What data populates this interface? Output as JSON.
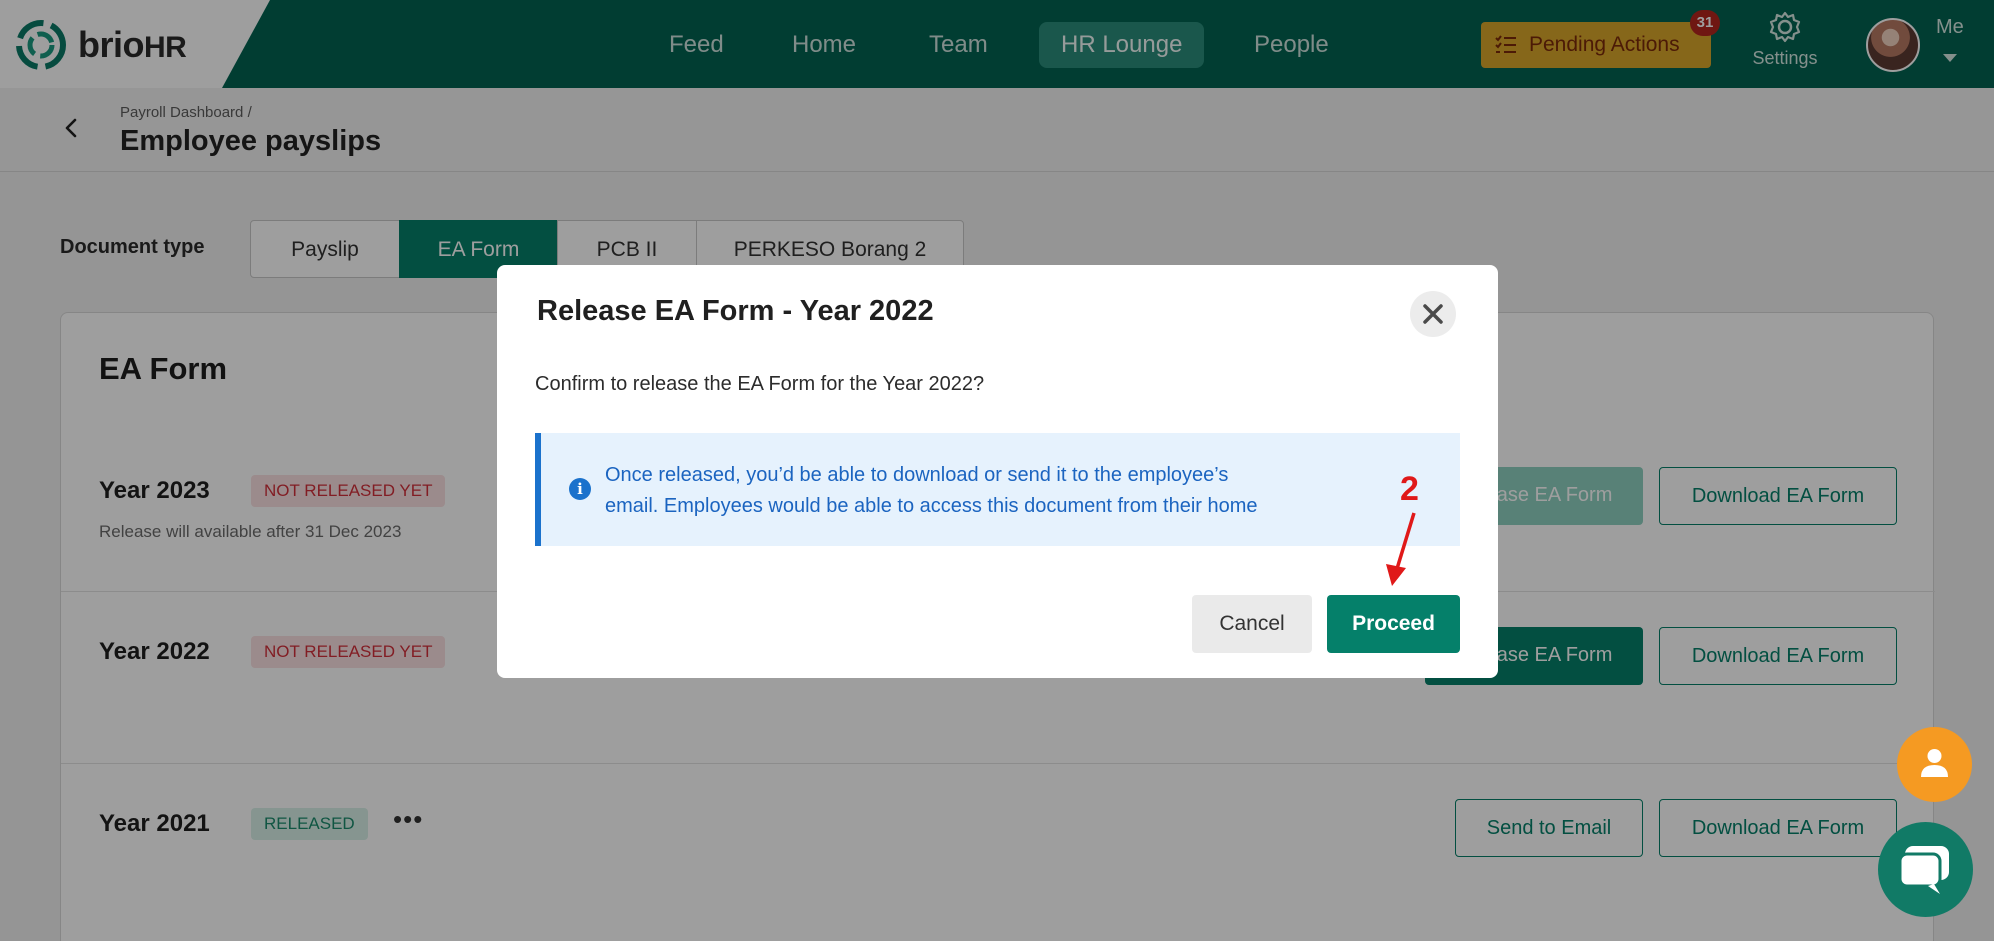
{
  "brand": {
    "name": "brio",
    "suffix": "HR"
  },
  "nav": {
    "items": [
      "Feed",
      "Home",
      "Team",
      "HR Lounge",
      "People"
    ],
    "active": "HR Lounge"
  },
  "header": {
    "pending_label": "Pending Actions",
    "pending_count": "31",
    "settings_label": "Settings",
    "me_label": "Me"
  },
  "breadcrumb": {
    "parent": "Payroll Dashboard",
    "separator": "/",
    "title": "Employee payslips"
  },
  "doc_type": {
    "label": "Document type",
    "tabs": [
      "Payslip",
      "EA Form",
      "PCB II",
      "PERKESO Borang 2"
    ],
    "active": "EA Form"
  },
  "card": {
    "title": "EA Form",
    "rows": [
      {
        "year": "Year 2023",
        "status": "NOT RELEASED YET",
        "note": "Release will available after 31 Dec 2023",
        "primary": "Release EA Form",
        "secondary": "Download EA Form"
      },
      {
        "year": "Year 2022",
        "status": "NOT RELEASED YET",
        "primary": "Release EA Form",
        "secondary": "Download EA Form"
      },
      {
        "year": "Year 2021",
        "status": "RELEASED",
        "more": "•••",
        "primary": "Send to Email",
        "secondary": "Download EA Form"
      }
    ]
  },
  "modal": {
    "title": "Release EA Form - Year 2022",
    "text": "Confirm to release the EA Form for the Year 2022?",
    "info_line1": "Once released, you’d be able to download or send it to the employee’s",
    "info_line2": "email. Employees would be able to access this document from their home",
    "cancel": "Cancel",
    "proceed": "Proceed"
  },
  "annotation": {
    "step": "2",
    "color": "#e01919"
  },
  "colors": {
    "brand": "#026352",
    "accent": "#05806a",
    "pending": "#d9a62a",
    "info": "#1b72cc",
    "danger": "#d22f3a"
  }
}
